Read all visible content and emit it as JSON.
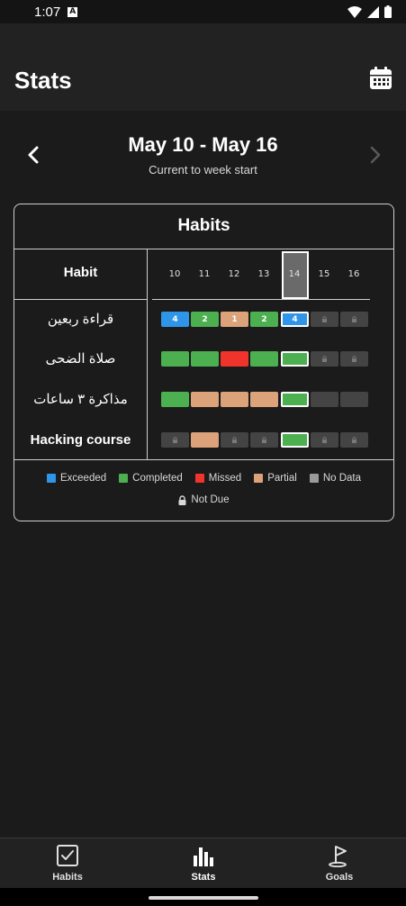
{
  "status_bar": {
    "time": "1:07"
  },
  "app_bar": {
    "title": "Stats"
  },
  "week": {
    "title": "May 10 - May 16",
    "subtitle": "Current to week start"
  },
  "card": {
    "title": "Habits",
    "habit_header": "Habit",
    "days": [
      "10",
      "11",
      "12",
      "13",
      "14",
      "15",
      "16"
    ],
    "selected_day": "14",
    "habits": [
      {
        "name": "قراءة ربعين",
        "bold": false,
        "cells": [
          {
            "status": "exceeded",
            "value": "4"
          },
          {
            "status": "completed",
            "value": "2"
          },
          {
            "status": "partial",
            "value": "1"
          },
          {
            "status": "completed",
            "value": "2"
          },
          {
            "status": "exceeded",
            "value": "4"
          },
          {
            "status": "not_due",
            "value": ""
          },
          {
            "status": "not_due",
            "value": ""
          }
        ]
      },
      {
        "name": "صلاة الضحى",
        "bold": false,
        "cells": [
          {
            "status": "completed",
            "value": ""
          },
          {
            "status": "completed",
            "value": ""
          },
          {
            "status": "missed",
            "value": ""
          },
          {
            "status": "completed",
            "value": ""
          },
          {
            "status": "completed",
            "value": ""
          },
          {
            "status": "not_due",
            "value": ""
          },
          {
            "status": "not_due",
            "value": ""
          }
        ]
      },
      {
        "name": "مذاكرة ٣ ساعات",
        "bold": false,
        "cells": [
          {
            "status": "completed",
            "value": ""
          },
          {
            "status": "partial",
            "value": ""
          },
          {
            "status": "partial",
            "value": ""
          },
          {
            "status": "partial",
            "value": ""
          },
          {
            "status": "completed",
            "value": ""
          },
          {
            "status": "no_data",
            "value": ""
          },
          {
            "status": "no_data",
            "value": ""
          }
        ]
      },
      {
        "name": "Hacking course",
        "bold": true,
        "cells": [
          {
            "status": "not_due",
            "value": ""
          },
          {
            "status": "partial",
            "value": ""
          },
          {
            "status": "not_due",
            "value": ""
          },
          {
            "status": "not_due",
            "value": ""
          },
          {
            "status": "completed",
            "value": ""
          },
          {
            "status": "not_due",
            "value": ""
          },
          {
            "status": "not_due",
            "value": ""
          }
        ]
      }
    ],
    "legend": [
      {
        "key": "exceeded",
        "label": "Exceeded",
        "color": "#2f95e8"
      },
      {
        "key": "completed",
        "label": "Completed",
        "color": "#4caf50"
      },
      {
        "key": "missed",
        "label": "Missed",
        "color": "#f0342c"
      },
      {
        "key": "partial",
        "label": "Partial",
        "color": "#dca37a"
      },
      {
        "key": "no_data",
        "label": "No Data",
        "color": "#9a9a9a"
      }
    ],
    "not_due_label": "Not Due"
  },
  "colors": {
    "exceeded": "#2f95e8",
    "completed": "#4caf50",
    "missed": "#f0342c",
    "partial": "#dca37a",
    "no_data": "#444444",
    "not_due": "#444444"
  },
  "bottom_nav": {
    "items": [
      {
        "label": "Habits",
        "icon": "checkbox-icon"
      },
      {
        "label": "Stats",
        "icon": "bar-chart-icon"
      },
      {
        "label": "Goals",
        "icon": "flag-icon"
      }
    ]
  }
}
